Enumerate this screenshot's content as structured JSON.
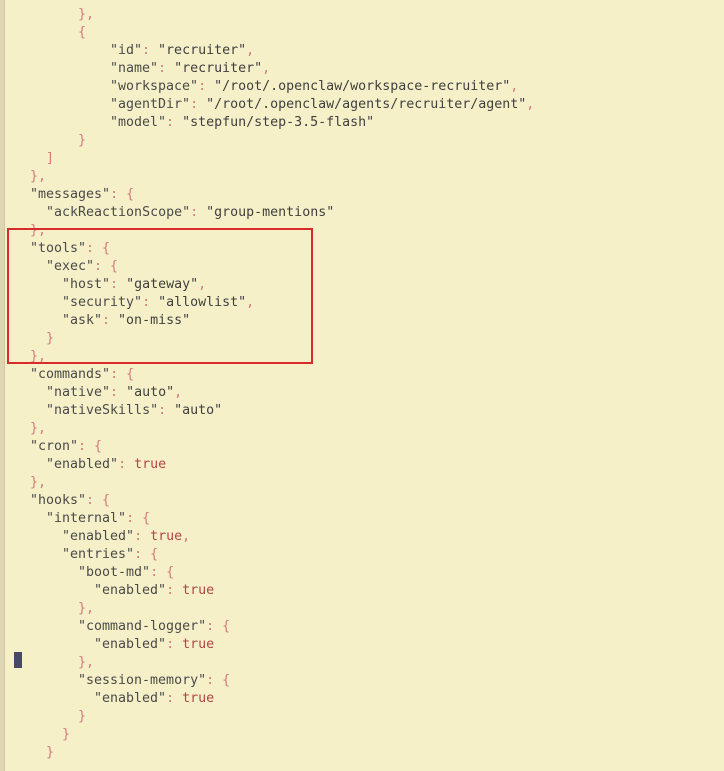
{
  "editor": {
    "lines": [
      {
        "indent": 4,
        "parts": [
          [
            "punct",
            "},"
          ]
        ]
      },
      {
        "indent": 4,
        "parts": [
          [
            "punct",
            "{"
          ]
        ]
      },
      {
        "indent": 6,
        "parts": [
          [
            "key",
            "\"id\""
          ],
          [
            "punct",
            ": "
          ],
          [
            "str",
            "\"recruiter\""
          ],
          [
            "punct",
            ","
          ]
        ]
      },
      {
        "indent": 6,
        "parts": [
          [
            "key",
            "\"name\""
          ],
          [
            "punct",
            ": "
          ],
          [
            "str",
            "\"recruiter\""
          ],
          [
            "punct",
            ","
          ]
        ]
      },
      {
        "indent": 6,
        "parts": [
          [
            "key",
            "\"workspace\""
          ],
          [
            "punct",
            ": "
          ],
          [
            "str",
            "\"/root/.openclaw/workspace-recruiter\""
          ],
          [
            "punct",
            ","
          ]
        ]
      },
      {
        "indent": 6,
        "parts": [
          [
            "key",
            "\"agentDir\""
          ],
          [
            "punct",
            ": "
          ],
          [
            "str",
            "\"/root/.openclaw/agents/recruiter/agent\""
          ],
          [
            "punct",
            ","
          ]
        ]
      },
      {
        "indent": 6,
        "parts": [
          [
            "key",
            "\"model\""
          ],
          [
            "punct",
            ": "
          ],
          [
            "str",
            "\"stepfun/step-3.5-flash\""
          ]
        ]
      },
      {
        "indent": 4,
        "parts": [
          [
            "punct",
            "}"
          ]
        ]
      },
      {
        "indent": 2,
        "parts": [
          [
            "punct",
            "]"
          ]
        ]
      },
      {
        "indent": 1,
        "parts": [
          [
            "punct",
            "},"
          ]
        ]
      },
      {
        "indent": 1,
        "parts": [
          [
            "key",
            "\"messages\""
          ],
          [
            "punct",
            ": {"
          ]
        ]
      },
      {
        "indent": 2,
        "parts": [
          [
            "key",
            "\"ackReactionScope\""
          ],
          [
            "punct",
            ": "
          ],
          [
            "str",
            "\"group-mentions\""
          ]
        ]
      },
      {
        "indent": 1,
        "parts": [
          [
            "punct",
            "},"
          ]
        ]
      },
      {
        "indent": 1,
        "parts": [
          [
            "key",
            "\"tools\""
          ],
          [
            "punct",
            ": {"
          ]
        ]
      },
      {
        "indent": 2,
        "parts": [
          [
            "key",
            "\"exec\""
          ],
          [
            "punct",
            ": {"
          ]
        ]
      },
      {
        "indent": 3,
        "parts": [
          [
            "key",
            "\"host\""
          ],
          [
            "punct",
            ": "
          ],
          [
            "str",
            "\"gateway\""
          ],
          [
            "punct",
            ","
          ]
        ]
      },
      {
        "indent": 3,
        "parts": [
          [
            "key",
            "\"security\""
          ],
          [
            "punct",
            ": "
          ],
          [
            "str",
            "\"allowlist\""
          ],
          [
            "punct",
            ","
          ]
        ]
      },
      {
        "indent": 3,
        "parts": [
          [
            "key",
            "\"ask\""
          ],
          [
            "punct",
            ": "
          ],
          [
            "str",
            "\"on-miss\""
          ]
        ]
      },
      {
        "indent": 2,
        "parts": [
          [
            "punct",
            "}"
          ]
        ]
      },
      {
        "indent": 1,
        "parts": [
          [
            "punct",
            "},"
          ]
        ]
      },
      {
        "indent": 1,
        "parts": [
          [
            "key",
            "\"commands\""
          ],
          [
            "punct",
            ": {"
          ]
        ]
      },
      {
        "indent": 2,
        "parts": [
          [
            "key",
            "\"native\""
          ],
          [
            "punct",
            ": "
          ],
          [
            "str",
            "\"auto\""
          ],
          [
            "punct",
            ","
          ]
        ]
      },
      {
        "indent": 2,
        "parts": [
          [
            "key",
            "\"nativeSkills\""
          ],
          [
            "punct",
            ": "
          ],
          [
            "str",
            "\"auto\""
          ]
        ]
      },
      {
        "indent": 1,
        "parts": [
          [
            "punct",
            "},"
          ]
        ]
      },
      {
        "indent": 1,
        "parts": [
          [
            "key",
            "\"cron\""
          ],
          [
            "punct",
            ": {"
          ]
        ]
      },
      {
        "indent": 2,
        "parts": [
          [
            "key",
            "\"enabled\""
          ],
          [
            "punct",
            ": "
          ],
          [
            "val",
            "true"
          ]
        ]
      },
      {
        "indent": 1,
        "parts": [
          [
            "punct",
            "},"
          ]
        ]
      },
      {
        "indent": 1,
        "parts": [
          [
            "key",
            "\"hooks\""
          ],
          [
            "punct",
            ": {"
          ]
        ]
      },
      {
        "indent": 2,
        "parts": [
          [
            "key",
            "\"internal\""
          ],
          [
            "punct",
            ": {"
          ]
        ]
      },
      {
        "indent": 3,
        "parts": [
          [
            "key",
            "\"enabled\""
          ],
          [
            "punct",
            ": "
          ],
          [
            "val",
            "true"
          ],
          [
            "punct",
            ","
          ]
        ]
      },
      {
        "indent": 3,
        "parts": [
          [
            "key",
            "\"entries\""
          ],
          [
            "punct",
            ": {"
          ]
        ]
      },
      {
        "indent": 4,
        "parts": [
          [
            "key",
            "\"boot-md\""
          ],
          [
            "punct",
            ": {"
          ]
        ]
      },
      {
        "indent": 5,
        "parts": [
          [
            "key",
            "\"enabled\""
          ],
          [
            "punct",
            ": "
          ],
          [
            "val",
            "true"
          ]
        ]
      },
      {
        "indent": 4,
        "parts": [
          [
            "punct",
            "},"
          ]
        ]
      },
      {
        "indent": 4,
        "parts": [
          [
            "key",
            "\"command-logger\""
          ],
          [
            "punct",
            ": {"
          ]
        ]
      },
      {
        "indent": 5,
        "parts": [
          [
            "key",
            "\"enabled\""
          ],
          [
            "punct",
            ": "
          ],
          [
            "val",
            "true"
          ]
        ]
      },
      {
        "indent": 4,
        "parts": [
          [
            "punct",
            "},"
          ]
        ]
      },
      {
        "indent": 4,
        "parts": [
          [
            "key",
            "\"session-memory\""
          ],
          [
            "punct",
            ": {"
          ]
        ]
      },
      {
        "indent": 5,
        "parts": [
          [
            "key",
            "\"enabled\""
          ],
          [
            "punct",
            ": "
          ],
          [
            "val",
            "true"
          ]
        ]
      },
      {
        "indent": 4,
        "parts": [
          [
            "punct",
            "}"
          ]
        ]
      },
      {
        "indent": 3,
        "parts": [
          [
            "punct",
            "}"
          ]
        ]
      },
      {
        "indent": 2,
        "parts": [
          [
            "punct",
            "}"
          ]
        ]
      }
    ]
  },
  "colors": {
    "background": "#f6f0c8",
    "highlight": "#d92b2b",
    "cursor": "#47476a"
  }
}
